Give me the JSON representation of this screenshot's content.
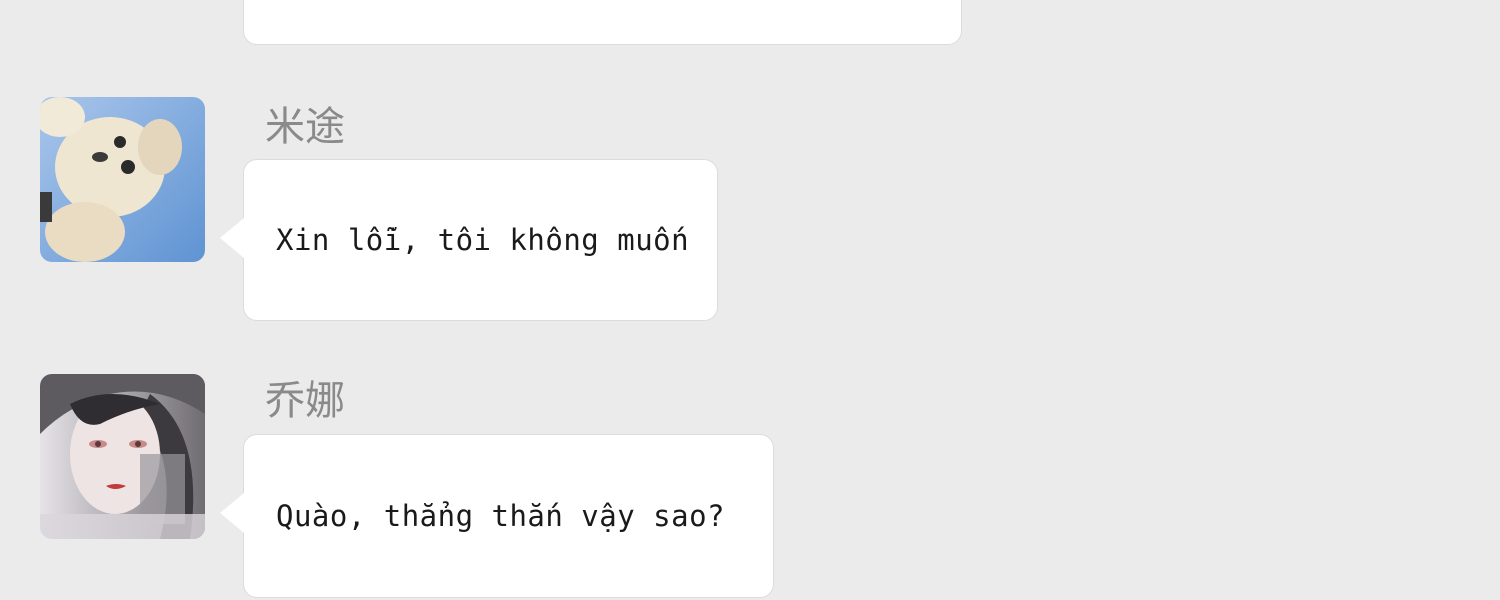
{
  "messages": [
    {
      "sender": "",
      "text": "",
      "avatar": "none"
    },
    {
      "sender": "米途",
      "text": "Xin lỗi, tôi không muốn",
      "avatar": "dog-avatar-icon"
    },
    {
      "sender": "乔娜",
      "text": "Quào, thẳng thắn vậy sao?",
      "avatar": "woman-avatar-icon"
    }
  ],
  "colors": {
    "background": "#ebebeb",
    "bubble": "#ffffff",
    "sender_name": "#8a8a8a",
    "message_text": "#1a1a1a"
  }
}
